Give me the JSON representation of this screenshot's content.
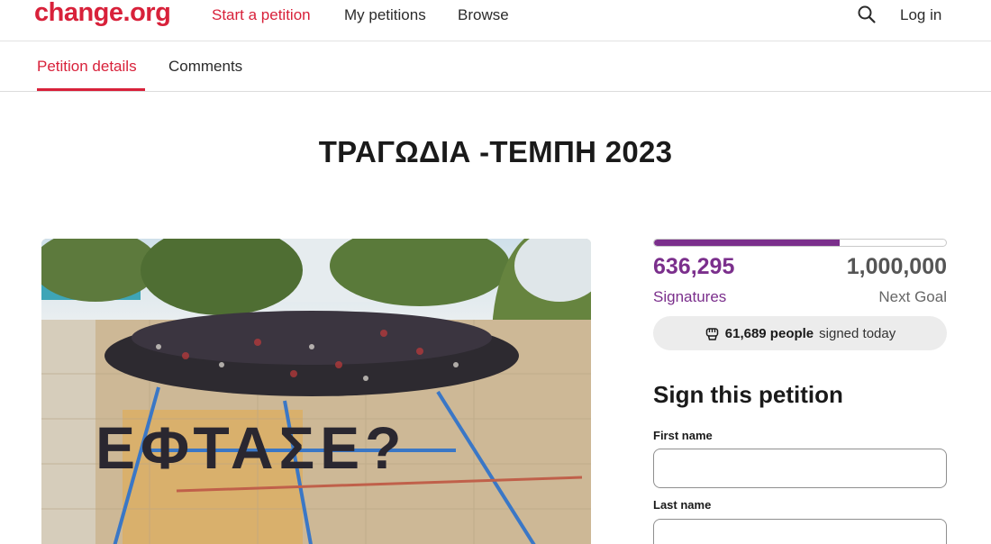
{
  "header": {
    "logo": "change.org",
    "nav": {
      "start_petition": "Start a petition",
      "my_petitions": "My petitions",
      "browse": "Browse"
    },
    "login": "Log in",
    "search_icon": "search-icon"
  },
  "tabs": {
    "details": "Petition details",
    "comments": "Comments"
  },
  "petition": {
    "title": "ΤΡΑΓΩΔΙΑ -ΤΕΜΠΗ 2023",
    "photo_text": "ΕΦΤΑΣΕ?"
  },
  "stats": {
    "signatures": "636,295",
    "signatures_label": "Signatures",
    "goal": "1,000,000",
    "goal_label": "Next Goal",
    "progress_fraction": 0.636,
    "today_count": "61,689 people",
    "today_suffix": "signed today"
  },
  "form": {
    "title": "Sign this petition",
    "first_name_label": "First name",
    "first_name_value": "",
    "last_name_label": "Last name",
    "last_name_value": ""
  },
  "colors": {
    "brand": "#d8213a",
    "progress": "#7b2f8c"
  }
}
